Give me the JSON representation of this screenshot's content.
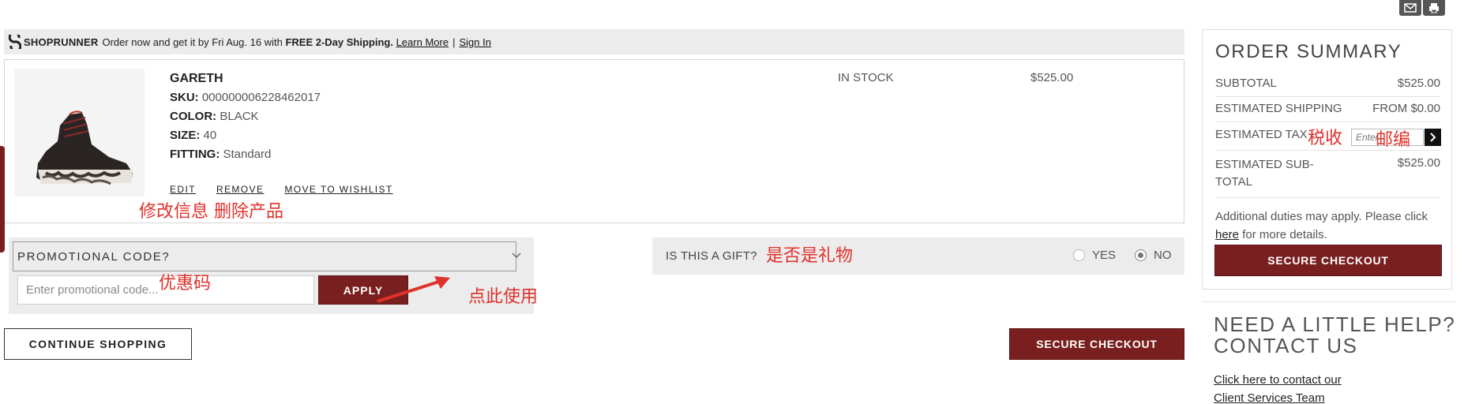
{
  "banner": {
    "brand": "SHOPRUNNER",
    "message": "Order now and get it by Fri Aug. 16 with",
    "highlight": "FREE 2-Day Shipping.",
    "learn_more": "Learn More",
    "separator": "|",
    "sign_in": "Sign In"
  },
  "item": {
    "name": "GARETH",
    "sku_label": "SKU:",
    "sku": "000000006228462017",
    "color_label": "COLOR:",
    "color": "BLACK",
    "size_label": "SIZE:",
    "size": "40",
    "fitting_label": "FITTING:",
    "fitting": "Standard",
    "stock": "IN STOCK",
    "price": "$525.00",
    "actions": [
      "EDIT",
      "REMOVE",
      "MOVE TO WISHLIST"
    ]
  },
  "promo": {
    "label": "PROMOTIONAL CODE?",
    "placeholder": "Enter promotional code...",
    "apply": "APPLY"
  },
  "gift": {
    "question": "IS THIS A GIFT?",
    "yes": "YES",
    "no": "NO",
    "selected": "NO"
  },
  "buttons": {
    "continue": "CONTINUE SHOPPING",
    "secure": "SECURE CHECKOUT"
  },
  "summary": {
    "title": "ORDER SUMMARY",
    "subtotal_label": "SUBTOTAL",
    "subtotal": "$525.00",
    "shipping_label": "ESTIMATED SHIPPING",
    "shipping": "FROM $0.00",
    "tax_label": "ESTIMATED TAX",
    "tax_placeholder": "Enter",
    "est_subtotal_label": "ESTIMATED SUB-TOTAL",
    "est_subtotal": "$525.00",
    "duties_text": "Additional duties may apply. Please click",
    "duties_link": "here",
    "duties_tail": "for more details.",
    "secure": "SECURE CHECKOUT"
  },
  "help": {
    "title": "NEED A LITTLE HELP? CONTACT US",
    "link": "Click here to contact our Client Services Team"
  },
  "annotations": {
    "edit_remove": "修改信息 删除产品",
    "tax": "税收",
    "zip": "邮编",
    "gift": "是否是礼物",
    "promo": "优惠码",
    "use_here": "点此使用"
  },
  "colors": {
    "accent": "#7a1f1f",
    "annotation": "#e0312b",
    "panel_bg": "#ececec"
  }
}
